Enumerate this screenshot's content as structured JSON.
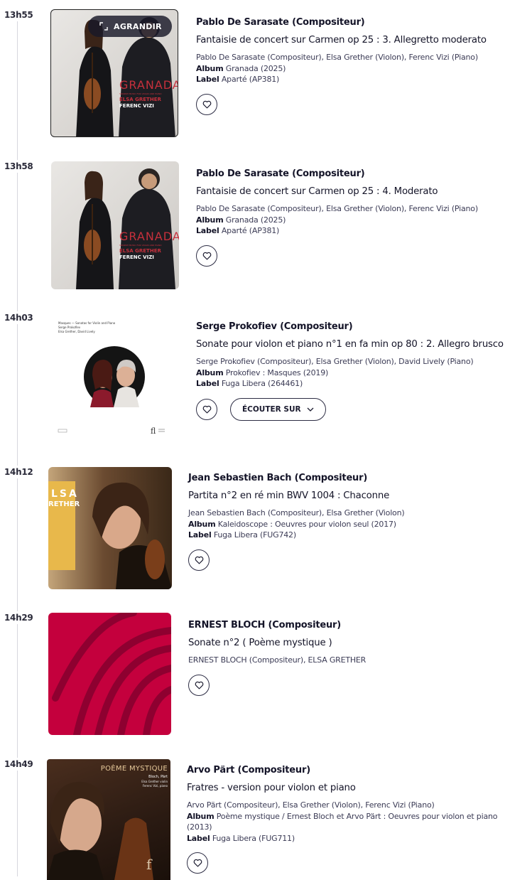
{
  "entries": [
    {
      "time": "13h55",
      "composer": "Pablo De Sarasate (Compositeur)",
      "work": "Fantaisie de concert sur Carmen op 25 : 3. Allegretto moderato",
      "performers": "Pablo De Sarasate (Compositeur), Elsa Grether (Violon), Ferenc Vizi (Piano)",
      "album_label": "Album",
      "album": "Granada (2025)",
      "label_label": "Label",
      "label": "Aparté (AP381)",
      "cover": {
        "title": "GRANADA",
        "subtitle": "SPANISH MUSIC FOR VIOLIN AND PIANO",
        "artist1": "ELSA GRETHER",
        "artist2": "FERENC VIZI"
      },
      "enlarge_label": "AGRANDIR"
    },
    {
      "time": "13h58",
      "composer": "Pablo De Sarasate (Compositeur)",
      "work": "Fantaisie de concert sur Carmen op 25 : 4. Moderato",
      "performers": "Pablo De Sarasate (Compositeur), Elsa Grether (Violon), Ferenc Vizi (Piano)",
      "album_label": "Album",
      "album": "Granada (2025)",
      "label_label": "Label",
      "label": "Aparté (AP381)",
      "cover": {
        "title": "GRANADA",
        "subtitle": "SPANISH MUSIC FOR VIOLIN AND PIANO",
        "artist1": "ELSA GRETHER",
        "artist2": "FERENC VIZI"
      }
    },
    {
      "time": "14h03",
      "composer": "Serge Prokofiev (Compositeur)",
      "work": "Sonate pour violon et piano n°1 en fa min op 80 : 2. Allegro brusco",
      "performers": "Serge Prokofiev (Compositeur), Elsa Grether (Violon), David Lively (Piano)",
      "album_label": "Album",
      "album": "Prokofiev : Masques (2019)",
      "label_label": "Label",
      "label": "Fuga Libera (264461)",
      "listen_label": "ÉCOUTER SUR",
      "cover": {
        "line1": "Masques — Sonatas for Violin and Piano",
        "line2": "Serge Prokofiev",
        "line3": "Elsa Grether, David Lively"
      }
    },
    {
      "time": "14h12",
      "composer": "Jean Sebastien Bach (Compositeur)",
      "work": "Partita n°2 en ré min BWV 1004 : Chaconne",
      "performers": "Jean Sebastien Bach (Compositeur), Elsa Grether (Violon)",
      "album_label": "Album",
      "album": "Kaleidoscope : Oeuvres pour violon seul (2017)",
      "label_label": "Label",
      "label": "Fuga Libera (FUG742)",
      "cover": {
        "name1": "LSA",
        "name2": "RETHER"
      }
    },
    {
      "time": "14h29",
      "composer": "ERNEST BLOCH (Compositeur)",
      "work": "Sonate n°2 ( Poème mystique )",
      "performers": "ERNEST BLOCH (Compositeur), ELSA GRETHER"
    },
    {
      "time": "14h49",
      "composer": "Arvo Pärt (Compositeur)",
      "work": "Fratres - version pour violon et piano",
      "performers": "Arvo Pärt (Compositeur), Elsa Grether (Violon), Ferenc Vizi (Piano)",
      "album_label": "Album",
      "album": "Poème mystique / Ernest Bloch et Arvo Pärt : Oeuvres pour violon et piano (2013)",
      "label_label": "Label",
      "label": "Fuga Libera (FUG711)",
      "cover": {
        "title": "POÈME MYSTIQUE",
        "line1": "Bloch, Pärt",
        "line2": "Elsa Grether violin",
        "line3": "Ferenc Vizi, piano"
      }
    }
  ],
  "colors": {
    "text": "#141428",
    "meta": "#3b3b55",
    "timeline": "#d6d6de",
    "granada_red": "#c6303c",
    "bloch_crimson": "#c4003d",
    "kaleido_yellow": "#e8b84b"
  },
  "icons": {
    "favorite": "heart-outline-icon",
    "enlarge": "expand-icon",
    "dropdown": "chevron-down-icon"
  }
}
